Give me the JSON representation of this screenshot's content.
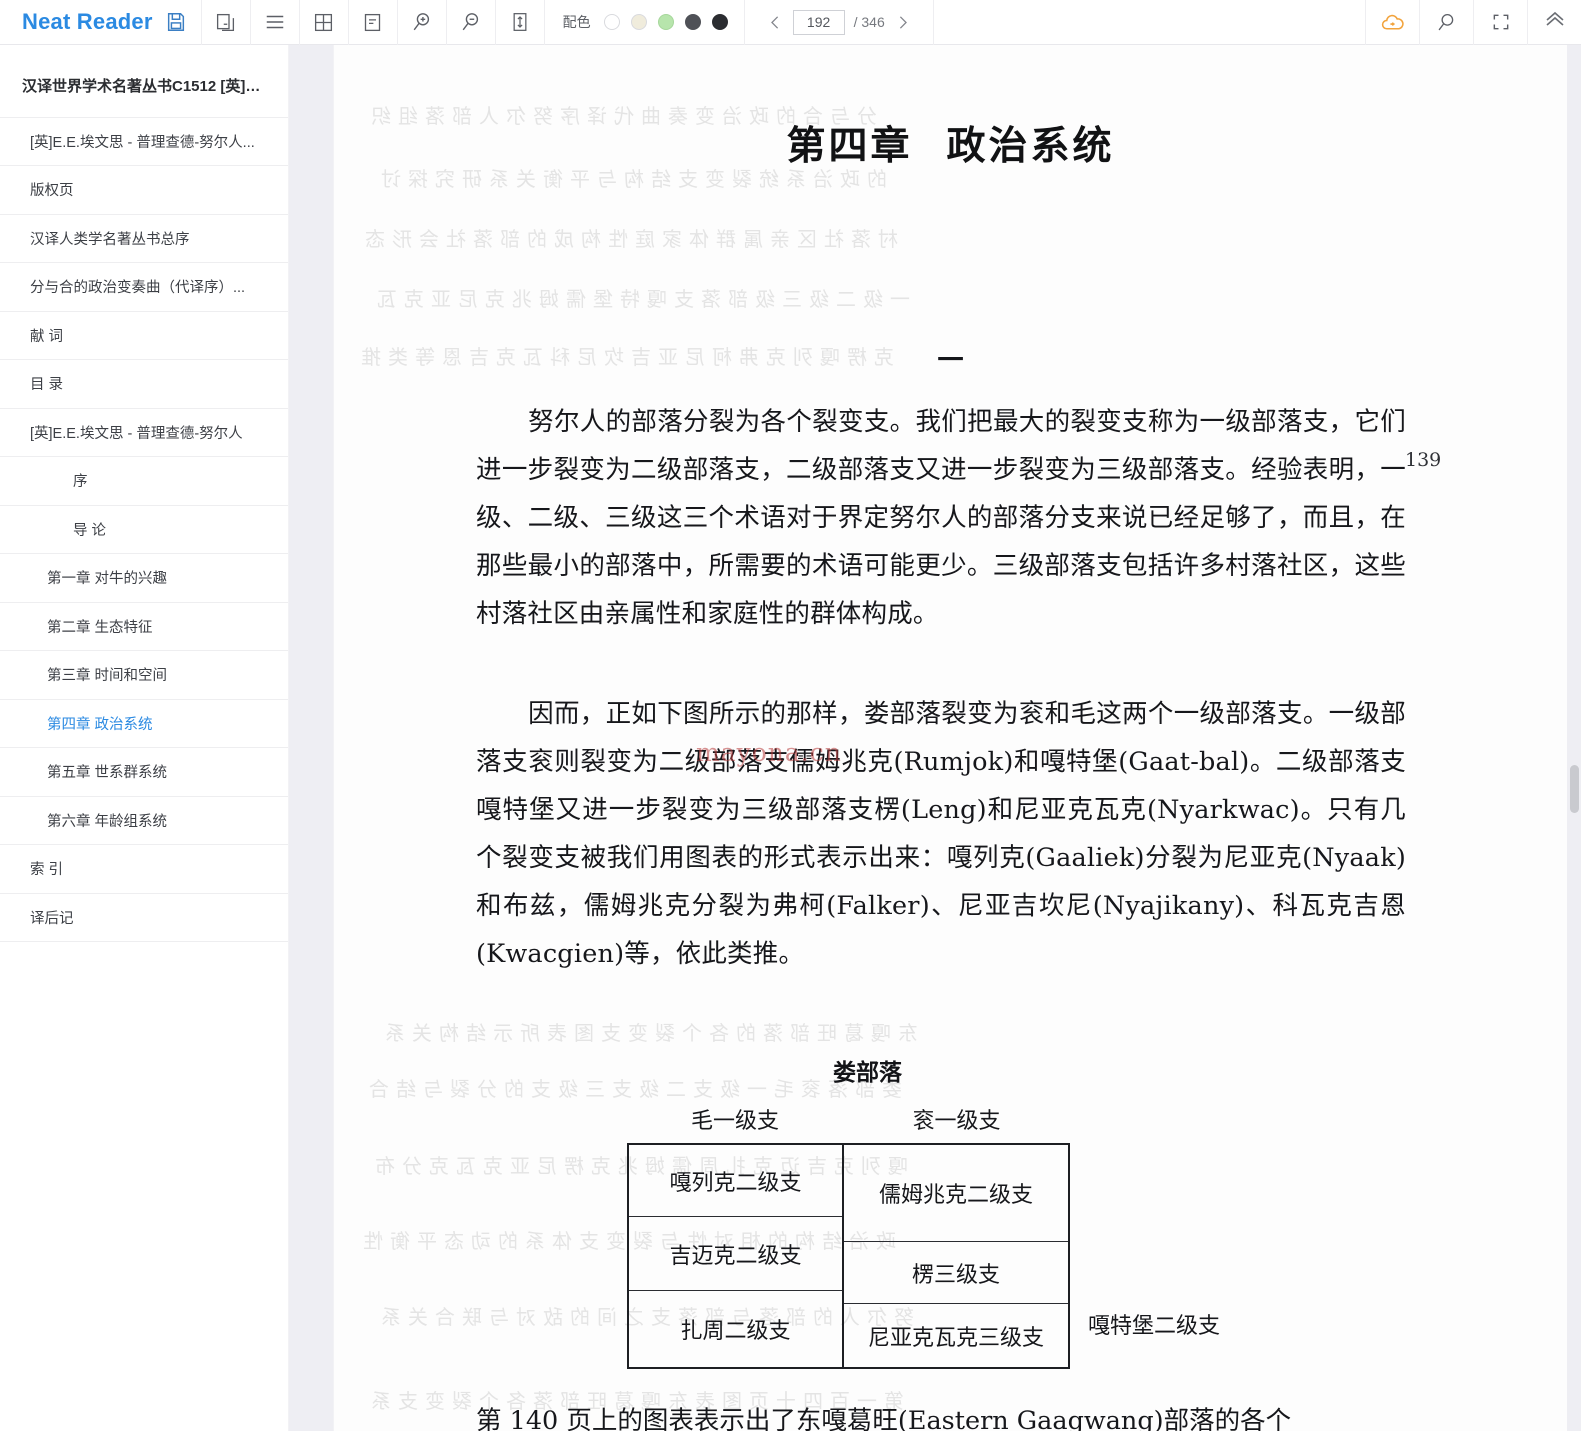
{
  "app": {
    "brand": "Neat Reader",
    "brand_color": "#2b8ae2"
  },
  "toolbar": {
    "icons": [
      {
        "name": "save-icon",
        "label": "保存"
      },
      {
        "name": "copy-icon",
        "label": "复制"
      },
      {
        "name": "menu-icon",
        "label": "目录"
      },
      {
        "name": "grid-icon",
        "label": "分栏"
      },
      {
        "name": "notes-icon",
        "label": "笔记"
      },
      {
        "name": "zoom-in-icon",
        "label": "放大"
      },
      {
        "name": "zoom-out-icon",
        "label": "缩小"
      },
      {
        "name": "fit-height-icon",
        "label": "适应高度"
      }
    ],
    "color_scheme": {
      "label": "配色",
      "swatches": [
        "#ffffff",
        "#f0ecdc",
        "#b7e5ac",
        "#4f5157",
        "#2b2d31"
      ]
    },
    "pager": {
      "prev": "‹",
      "next": "›",
      "current_page": "192",
      "total_label": "/ 346",
      "total": "346"
    },
    "right_icons": [
      {
        "name": "cloud-sync-icon",
        "label": "云同步",
        "color": "#f2a33c"
      },
      {
        "name": "search-icon",
        "label": "搜索"
      },
      {
        "name": "fullscreen-icon",
        "label": "全屏"
      },
      {
        "name": "collapse-up-icon",
        "label": "收起工具栏"
      }
    ]
  },
  "sidebar": {
    "title": "汉译世界学术名著丛书C1512 [英]E.E....",
    "items": [
      {
        "label": "[英]E.E.埃文思 - 普理查德-努尔人...",
        "level": 1,
        "active": false
      },
      {
        "label": "版权页",
        "level": 1,
        "active": false
      },
      {
        "label": "汉译人类学名著丛书总序",
        "level": 1,
        "active": false
      },
      {
        "label": "分与合的政治变奏曲（代译序）...",
        "level": 1,
        "active": false
      },
      {
        "label": "献 词",
        "level": 1,
        "active": false
      },
      {
        "label": "目 录",
        "level": 1,
        "active": false
      },
      {
        "label": "[英]E.E.埃文思 - 普理查德-努尔人",
        "level": 1,
        "active": false
      },
      {
        "label": "序",
        "level": 2,
        "active": false
      },
      {
        "label": "导 论",
        "level": 2,
        "active": false
      },
      {
        "label": "第一章 对牛的兴趣",
        "level": 2,
        "active": false
      },
      {
        "label": "第二章 生态特征",
        "level": 2,
        "active": false
      },
      {
        "label": "第三章 时间和空间",
        "level": 2,
        "active": false
      },
      {
        "label": "第四章 政治系统",
        "level": 2,
        "active": true
      },
      {
        "label": "第五章 世系群系统",
        "level": 2,
        "active": false
      },
      {
        "label": "第六章 年龄组系统",
        "level": 2,
        "active": false
      },
      {
        "label": "索 引",
        "level": 1,
        "active": false
      },
      {
        "label": "译后记",
        "level": 1,
        "active": false
      }
    ]
  },
  "page": {
    "chapter_prefix": "第四章",
    "chapter_title": "政治系统",
    "section_number": "一",
    "margin_page_number": "139",
    "watermark": "mayona.cn",
    "paragraph_1": "努尔人的部落分裂为各个裂变支。我们把最大的裂变支称为一级部落支，它们进一步裂变为二级部落支，二级部落支又进一步裂变为三级部落支。经验表明，一级、二级、三级这三个术语对于界定努尔人的部落分支来说已经足够了，而且，在那些最小的部落中，所需要的术语可能更少。三级部落支包括许多村落社区，这些村落社区由亲属性和家庭性的群体构成。",
    "paragraph_2": "因而，正如下图所示的那样，娄部落裂变为衮和毛这两个一级部落支。一级部落支衮则裂变为二级部落支儒姆兆克(Rumjok)和嘎特堡(Gaat-bal)。二级部落支嘎特堡又进一步裂变为三级部落支楞(Leng)和尼亚克瓦克(Nyarkwac)。只有几个裂变支被我们用图表的形式表示出来：嘎列克(Gaaliek)分裂为尼亚克(Nyaak)和布兹，儒姆兆克分裂为弗柯(Falker)、尼亚吉坎尼(Nyajikany)、科瓦克吉恩(Kwacgien)等，依此类推。",
    "bottom_line": "第 140 页上的图表表示出了东嘎葛旺(Eastern Gaagwang)部落的各个",
    "diagram": {
      "title": "娄部落",
      "col_header_left": "毛一级支",
      "col_header_right": "衮一级支",
      "left_cells": [
        "嘎列克二级支",
        "吉迈克二级支",
        "扎周二级支"
      ],
      "right_cells": [
        "儒姆兆克二级支",
        "楞三级支",
        "尼亚克瓦克三级支"
      ],
      "side_label": "嘎特堡二级支"
    }
  }
}
